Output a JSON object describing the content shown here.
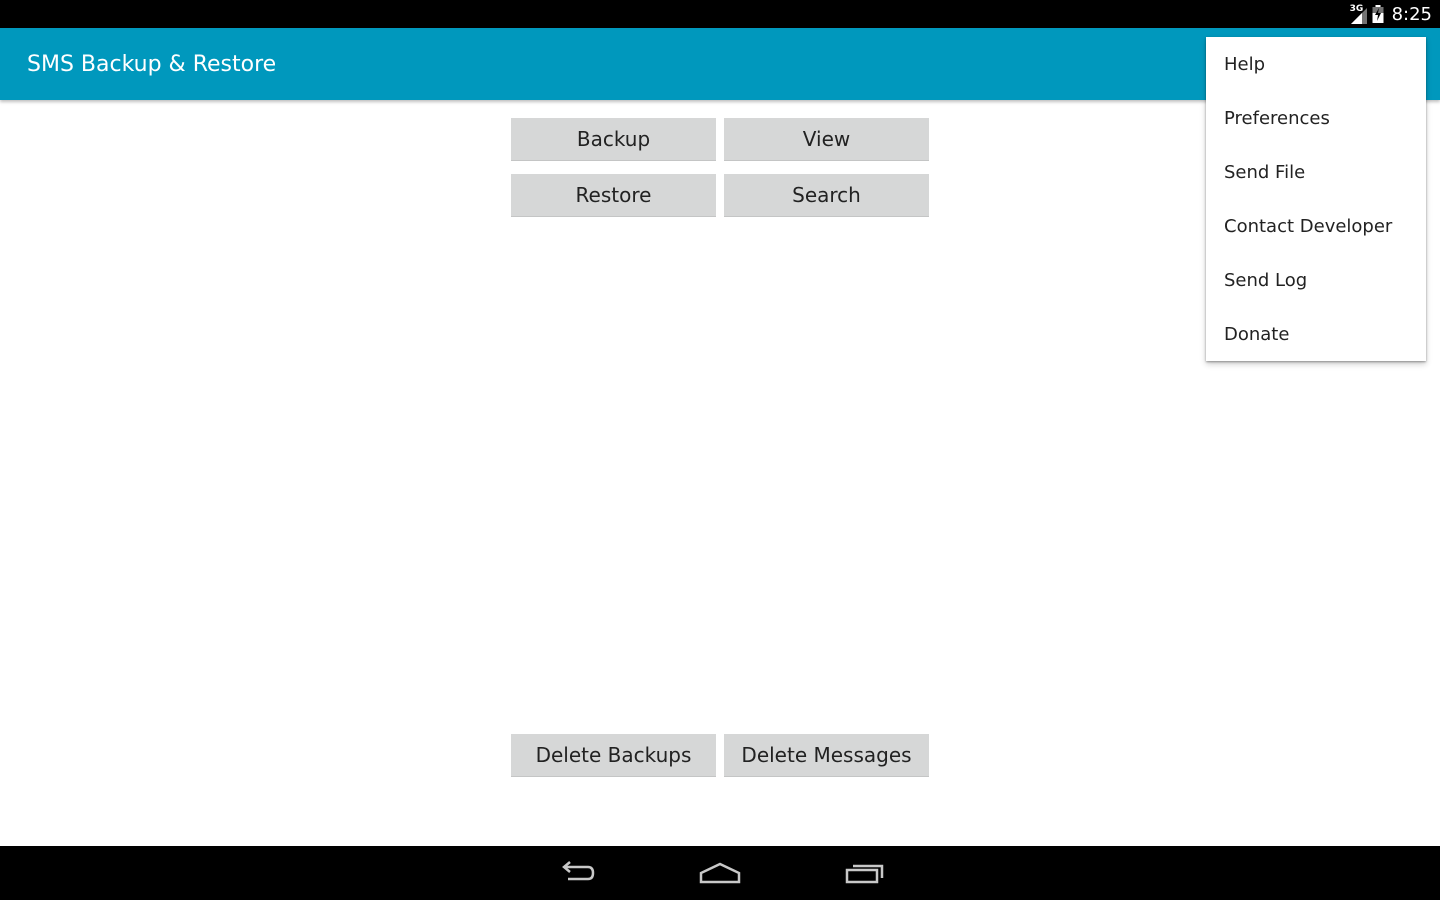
{
  "status_bar": {
    "network_type": "3G",
    "time": "8:25",
    "icons": [
      "signal-icon",
      "battery-icon"
    ]
  },
  "action_bar": {
    "title": "SMS Backup & Restore",
    "color": "#0098bd"
  },
  "main": {
    "backup_label": "Backup",
    "view_label": "View",
    "restore_label": "Restore",
    "search_label": "Search",
    "delete_backups_label": "Delete Backups",
    "delete_messages_label": "Delete Messages"
  },
  "overflow_menu": {
    "items": [
      {
        "label": "Help"
      },
      {
        "label": "Preferences"
      },
      {
        "label": "Send File"
      },
      {
        "label": "Contact Developer"
      },
      {
        "label": "Send Log"
      },
      {
        "label": "Donate"
      }
    ]
  },
  "nav_bar": {
    "icons": [
      "back-icon",
      "home-icon",
      "recents-icon"
    ]
  }
}
